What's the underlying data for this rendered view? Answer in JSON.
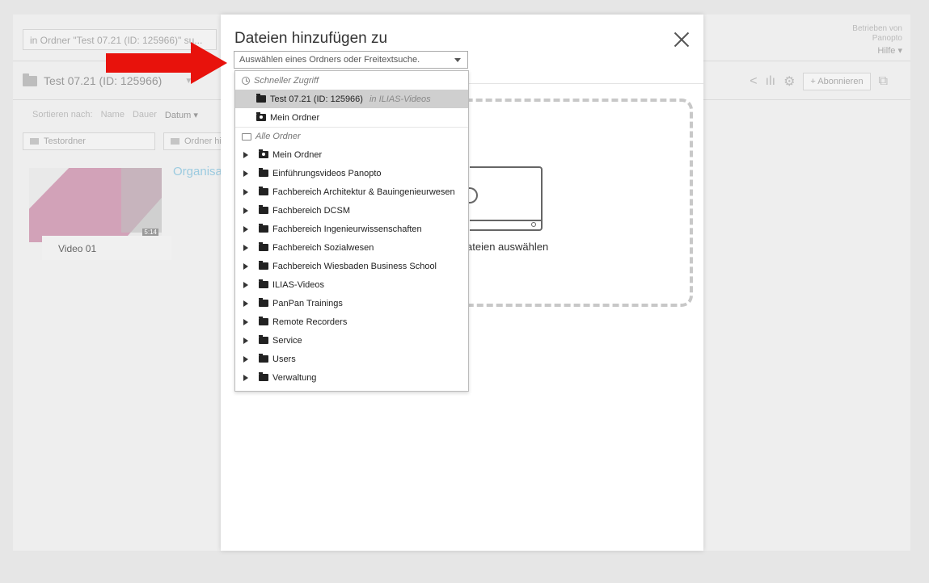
{
  "background": {
    "search_placeholder": "in Ordner \"Test 07.21 (ID: 125966)\" su...",
    "powered_by": "Betrieben von Panopto",
    "help_label": "Hilfe",
    "folder_title": "Test 07.21 (ID: 125966)",
    "subscribe_label": "+ Abonnieren",
    "sort_label": "Sortieren nach:",
    "sort_options": [
      "Name",
      "Dauer",
      "Datum"
    ],
    "subfolders": [
      "Testordner",
      "Ordner hi"
    ],
    "video_title": "Video 01",
    "video_duration": "5:14",
    "org_link": "Organisa"
  },
  "modal": {
    "title": "Dateien hinzufügen zu",
    "select_placeholder": "Auswählen eines Ordners oder Freitextsuche.",
    "choose_files_text": "ateien auswählen"
  },
  "dropdown": {
    "quick_access_header": "Schneller Zugriff",
    "quick_items": [
      {
        "label": "Test 07.21 (ID: 125966)",
        "hint": "in ILIAS-Videos"
      },
      {
        "label": "Mein Ordner",
        "hint": ""
      }
    ],
    "all_folders_header": "Alle Ordner",
    "folders": [
      "Mein Ordner",
      "Einführungsvideos Panopto",
      "Fachbereich Architektur & Bauingenieurwesen",
      "Fachbereich DCSM",
      "Fachbereich Ingenieurwissenschaften",
      "Fachbereich Sozialwesen",
      "Fachbereich Wiesbaden Business School",
      "ILIAS-Videos",
      "PanPan Trainings",
      "Remote Recorders",
      "Service",
      "Users",
      "Verwaltung"
    ]
  },
  "colors": {
    "arrow": "#e8120c",
    "selected_row": "#cfcfcf",
    "link": "#9ccbe0"
  }
}
